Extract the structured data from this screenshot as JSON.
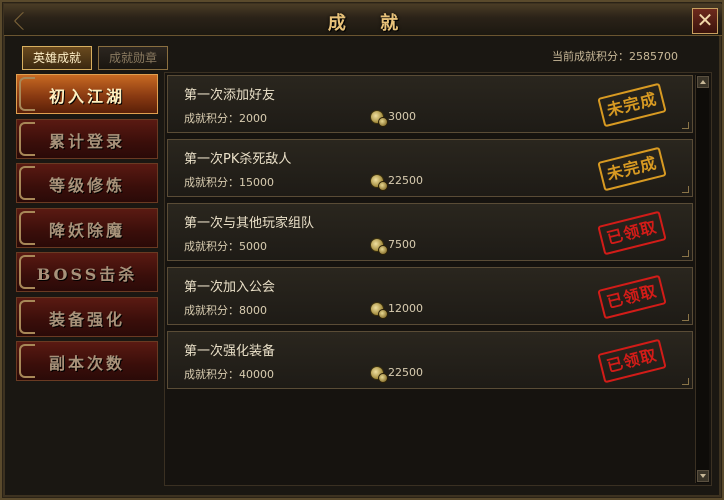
{
  "window": {
    "title": "成  就",
    "close_glyph": "✕"
  },
  "tabs": [
    {
      "label": "英雄成就",
      "active": true
    },
    {
      "label": "成就勋章",
      "active": false
    }
  ],
  "score": {
    "label": "当前成就积分：2585700"
  },
  "categories": [
    {
      "label": "初入江湖",
      "active": true
    },
    {
      "label": "累计登录",
      "active": false
    },
    {
      "label": "等级修炼",
      "active": false
    },
    {
      "label": "降妖除魔",
      "active": false
    },
    {
      "label": "BOSS击杀",
      "active": false
    },
    {
      "label": "装备强化",
      "active": false
    },
    {
      "label": "副本次数",
      "active": false
    }
  ],
  "achievements": [
    {
      "title": "第一次添加好友",
      "points": "成就积分：2000",
      "reward": "3000",
      "status": "未完成",
      "status_type": "incomplete"
    },
    {
      "title": "第一次PK杀死敌人",
      "points": "成就积分：15000",
      "reward": "22500",
      "status": "未完成",
      "status_type": "incomplete"
    },
    {
      "title": "第一次与其他玩家组队",
      "points": "成就积分：5000",
      "reward": "7500",
      "status": "已领取",
      "status_type": "claimed"
    },
    {
      "title": "第一次加入公会",
      "points": "成就积分：8000",
      "reward": "12000",
      "status": "已领取",
      "status_type": "claimed"
    },
    {
      "title": "第一次强化装备",
      "points": "成就积分：40000",
      "reward": "22500",
      "status": "已领取",
      "status_type": "claimed"
    }
  ],
  "colors": {
    "incomplete_stamp": "#d89a22",
    "claimed_stamp": "#d21c18",
    "title_gold": "#e8c27a"
  },
  "icons": {
    "coin": "coin-icon",
    "close": "close-icon"
  }
}
